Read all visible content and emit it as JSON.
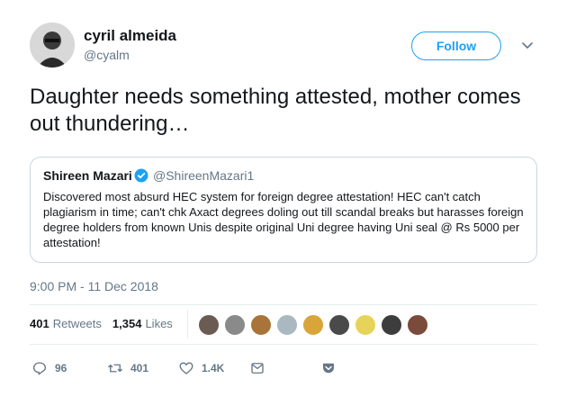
{
  "author": {
    "name": "cyril almeida",
    "handle": "@cyalm"
  },
  "follow_label": "Follow",
  "tweet_text": "Daughter needs something attested, mother comes out thundering…",
  "quote": {
    "name": "Shireen Mazari",
    "handle": "@ShireenMazari1",
    "text": "Discovered most absurd HEC system for foreign degree attestation! HEC can't catch plagiarism in time; can't chk Axact degrees doling out till scandal breaks but harasses foreign degree holders from known Unis despite original Uni degree having Uni seal @ Rs 5000 per attestation!"
  },
  "timestamp": "9:00 PM - 11 Dec 2018",
  "stats": {
    "retweets_count": "401",
    "retweets_label": "Retweets",
    "likes_count": "1,354",
    "likes_label": "Likes"
  },
  "liker_colors": [
    "#6b5b53",
    "#8a8a8a",
    "#a8743a",
    "#aab8c2",
    "#d9a53a",
    "#4a4a4a",
    "#e8d35a",
    "#3d3d3d",
    "#7a4b3a"
  ],
  "actions": {
    "replies": "96",
    "retweets": "401",
    "likes": "1.4K"
  },
  "colors": {
    "accent": "#1da1f2",
    "secondary_text": "#657786",
    "border": "#ccd6dd"
  }
}
